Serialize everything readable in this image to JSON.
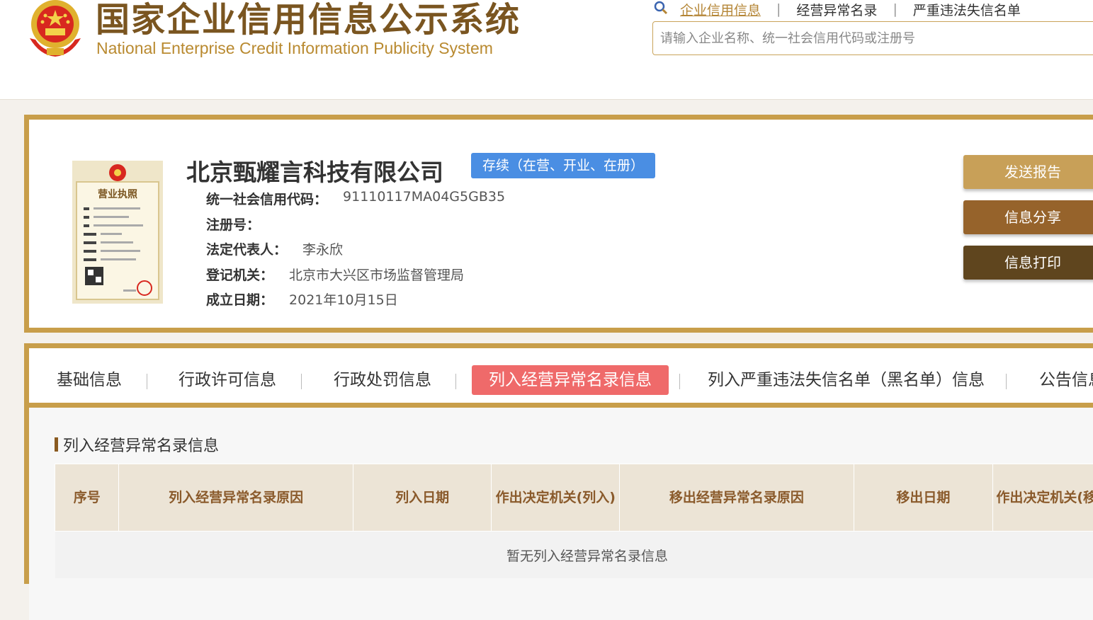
{
  "header": {
    "title_cn": "国家企业信用信息公示系统",
    "title_en": "National Enterprise Credit Information Publicity System",
    "top_links": [
      "企业信用信息",
      "经营异常名录",
      "严重违法失信名单"
    ],
    "search_placeholder": "请输入企业名称、统一社会信用代码或注册号",
    "search_value": ""
  },
  "company": {
    "name": "北京甄耀言科技有限公司",
    "status": "存续（在营、开业、在册）",
    "license_title": "营业执照",
    "fields": [
      {
        "label": "统一社会信用代码：",
        "value": "91110117MA04G5GB35"
      },
      {
        "label": "注册号：",
        "value": ""
      },
      {
        "label": "法定代表人：",
        "value": "李永欣"
      },
      {
        "label": "登记机关：",
        "value": "北京市大兴区市场监督管理局"
      },
      {
        "label": "成立日期：",
        "value": "2021年10月15日"
      }
    ]
  },
  "actions": {
    "send_report": "发送报告",
    "share": "信息分享",
    "print": "信息打印"
  },
  "tabs": [
    "基础信息",
    "行政许可信息",
    "行政处罚信息",
    "列入经营异常名录信息",
    "列入严重违法失信名单（黑名单）信息",
    "公告信息"
  ],
  "active_tab": "列入经营异常名录信息",
  "section": {
    "title": "列入经营异常名录信息",
    "columns": [
      "序号",
      "列入经营异常名录原因",
      "列入日期",
      "作出决定机关(列入)",
      "移出经营异常名录原因",
      "移出日期",
      "作出决定机关(移出)"
    ],
    "empty_text": "暂无列入经营异常名录信息"
  },
  "colors": {
    "gold": "#c89e4a",
    "brown_text": "#7a5520",
    "status_blue": "#4a8ee3",
    "active_tab_red": "#ef6a6a",
    "btn_send": "#c8a058",
    "btn_share": "#96632b",
    "btn_print": "#5f451e"
  }
}
